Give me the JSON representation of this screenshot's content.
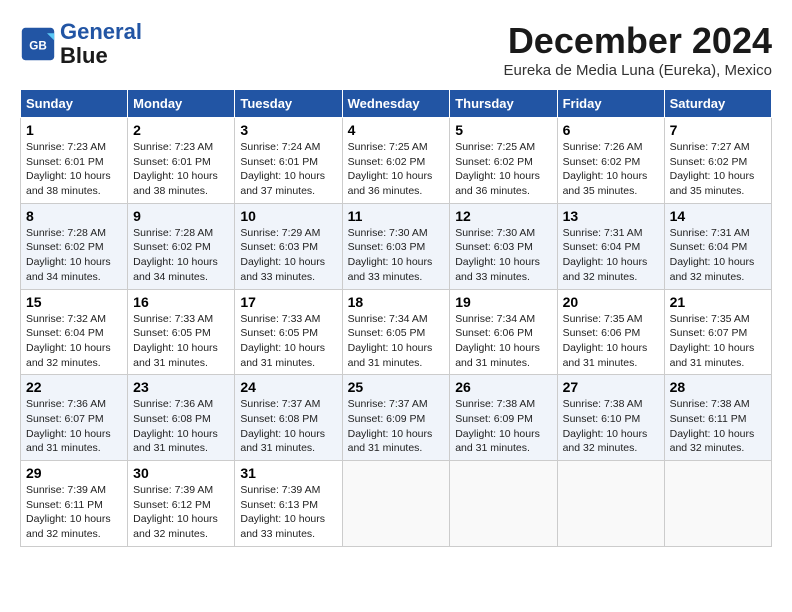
{
  "header": {
    "logo_line1": "General",
    "logo_line2": "Blue",
    "month": "December 2024",
    "location": "Eureka de Media Luna (Eureka), Mexico"
  },
  "weekdays": [
    "Sunday",
    "Monday",
    "Tuesday",
    "Wednesday",
    "Thursday",
    "Friday",
    "Saturday"
  ],
  "weeks": [
    [
      {
        "day": "1",
        "info": "Sunrise: 7:23 AM\nSunset: 6:01 PM\nDaylight: 10 hours\nand 38 minutes."
      },
      {
        "day": "2",
        "info": "Sunrise: 7:23 AM\nSunset: 6:01 PM\nDaylight: 10 hours\nand 38 minutes."
      },
      {
        "day": "3",
        "info": "Sunrise: 7:24 AM\nSunset: 6:01 PM\nDaylight: 10 hours\nand 37 minutes."
      },
      {
        "day": "4",
        "info": "Sunrise: 7:25 AM\nSunset: 6:02 PM\nDaylight: 10 hours\nand 36 minutes."
      },
      {
        "day": "5",
        "info": "Sunrise: 7:25 AM\nSunset: 6:02 PM\nDaylight: 10 hours\nand 36 minutes."
      },
      {
        "day": "6",
        "info": "Sunrise: 7:26 AM\nSunset: 6:02 PM\nDaylight: 10 hours\nand 35 minutes."
      },
      {
        "day": "7",
        "info": "Sunrise: 7:27 AM\nSunset: 6:02 PM\nDaylight: 10 hours\nand 35 minutes."
      }
    ],
    [
      {
        "day": "8",
        "info": "Sunrise: 7:28 AM\nSunset: 6:02 PM\nDaylight: 10 hours\nand 34 minutes."
      },
      {
        "day": "9",
        "info": "Sunrise: 7:28 AM\nSunset: 6:02 PM\nDaylight: 10 hours\nand 34 minutes."
      },
      {
        "day": "10",
        "info": "Sunrise: 7:29 AM\nSunset: 6:03 PM\nDaylight: 10 hours\nand 33 minutes."
      },
      {
        "day": "11",
        "info": "Sunrise: 7:30 AM\nSunset: 6:03 PM\nDaylight: 10 hours\nand 33 minutes."
      },
      {
        "day": "12",
        "info": "Sunrise: 7:30 AM\nSunset: 6:03 PM\nDaylight: 10 hours\nand 33 minutes."
      },
      {
        "day": "13",
        "info": "Sunrise: 7:31 AM\nSunset: 6:04 PM\nDaylight: 10 hours\nand 32 minutes."
      },
      {
        "day": "14",
        "info": "Sunrise: 7:31 AM\nSunset: 6:04 PM\nDaylight: 10 hours\nand 32 minutes."
      }
    ],
    [
      {
        "day": "15",
        "info": "Sunrise: 7:32 AM\nSunset: 6:04 PM\nDaylight: 10 hours\nand 32 minutes."
      },
      {
        "day": "16",
        "info": "Sunrise: 7:33 AM\nSunset: 6:05 PM\nDaylight: 10 hours\nand 31 minutes."
      },
      {
        "day": "17",
        "info": "Sunrise: 7:33 AM\nSunset: 6:05 PM\nDaylight: 10 hours\nand 31 minutes."
      },
      {
        "day": "18",
        "info": "Sunrise: 7:34 AM\nSunset: 6:05 PM\nDaylight: 10 hours\nand 31 minutes."
      },
      {
        "day": "19",
        "info": "Sunrise: 7:34 AM\nSunset: 6:06 PM\nDaylight: 10 hours\nand 31 minutes."
      },
      {
        "day": "20",
        "info": "Sunrise: 7:35 AM\nSunset: 6:06 PM\nDaylight: 10 hours\nand 31 minutes."
      },
      {
        "day": "21",
        "info": "Sunrise: 7:35 AM\nSunset: 6:07 PM\nDaylight: 10 hours\nand 31 minutes."
      }
    ],
    [
      {
        "day": "22",
        "info": "Sunrise: 7:36 AM\nSunset: 6:07 PM\nDaylight: 10 hours\nand 31 minutes."
      },
      {
        "day": "23",
        "info": "Sunrise: 7:36 AM\nSunset: 6:08 PM\nDaylight: 10 hours\nand 31 minutes."
      },
      {
        "day": "24",
        "info": "Sunrise: 7:37 AM\nSunset: 6:08 PM\nDaylight: 10 hours\nand 31 minutes."
      },
      {
        "day": "25",
        "info": "Sunrise: 7:37 AM\nSunset: 6:09 PM\nDaylight: 10 hours\nand 31 minutes."
      },
      {
        "day": "26",
        "info": "Sunrise: 7:38 AM\nSunset: 6:09 PM\nDaylight: 10 hours\nand 31 minutes."
      },
      {
        "day": "27",
        "info": "Sunrise: 7:38 AM\nSunset: 6:10 PM\nDaylight: 10 hours\nand 32 minutes."
      },
      {
        "day": "28",
        "info": "Sunrise: 7:38 AM\nSunset: 6:11 PM\nDaylight: 10 hours\nand 32 minutes."
      }
    ],
    [
      {
        "day": "29",
        "info": "Sunrise: 7:39 AM\nSunset: 6:11 PM\nDaylight: 10 hours\nand 32 minutes."
      },
      {
        "day": "30",
        "info": "Sunrise: 7:39 AM\nSunset: 6:12 PM\nDaylight: 10 hours\nand 32 minutes."
      },
      {
        "day": "31",
        "info": "Sunrise: 7:39 AM\nSunset: 6:13 PM\nDaylight: 10 hours\nand 33 minutes."
      },
      null,
      null,
      null,
      null
    ]
  ]
}
